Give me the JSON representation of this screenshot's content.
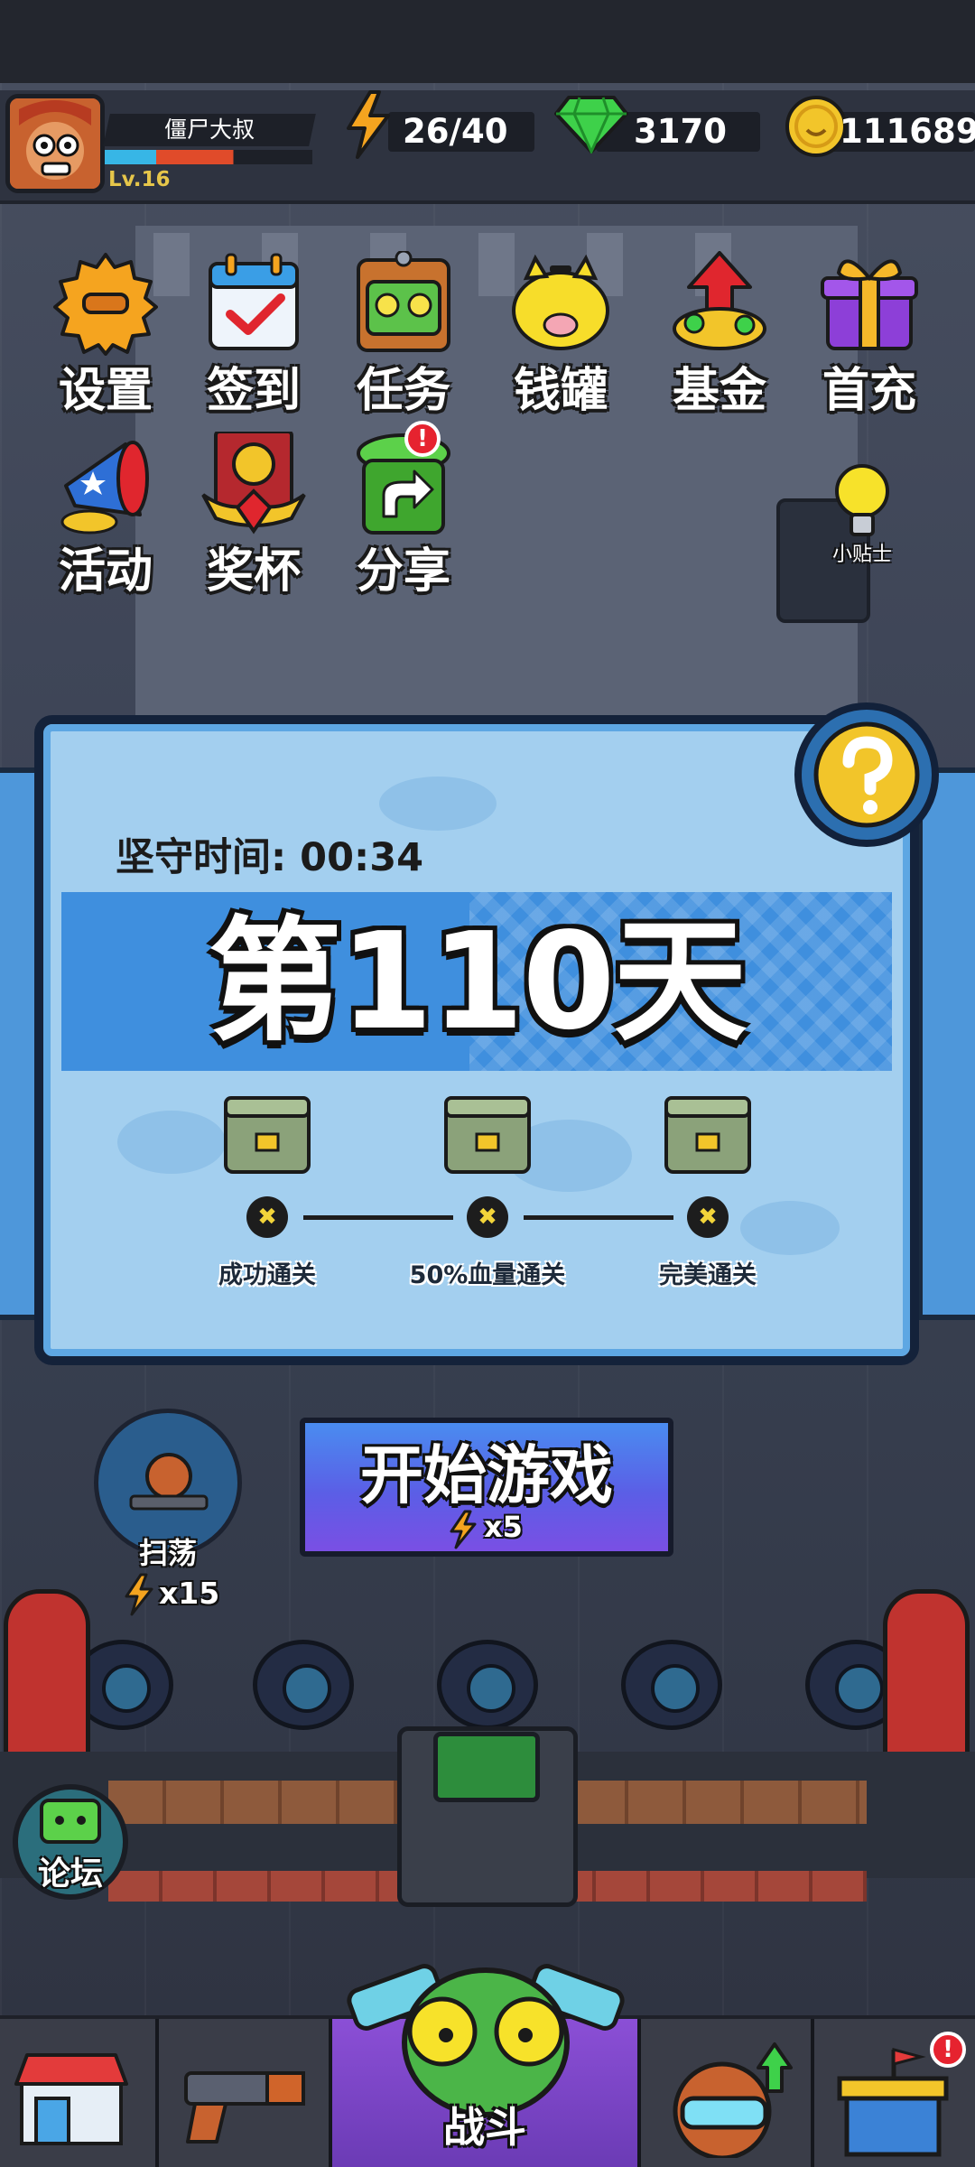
{
  "player": {
    "name": "僵尸大叔",
    "level": "Lv.16",
    "xp_fraction": 0.62
  },
  "resources": {
    "energy": "26/40",
    "gems": "3170",
    "coins": "111689"
  },
  "menu": {
    "settings": "设置",
    "checkin": "签到",
    "tasks": "任务",
    "piggybank": "钱罐",
    "fund": "基金",
    "first_recharge": "首充",
    "events": "活动",
    "trophy": "奖杯",
    "share": "分享"
  },
  "tips": {
    "label": "小贴士"
  },
  "level_panel": {
    "hold_time": "坚守时间: 00:34",
    "day_title": "第110天",
    "goals": [
      "成功通关",
      "50%血量通关",
      "完美通关"
    ]
  },
  "start": {
    "label": "开始游戏",
    "cost": "x5"
  },
  "sweep": {
    "label": "扫荡",
    "cost": "x15"
  },
  "forum": {
    "label": "论坛"
  },
  "nav": {
    "battle": "战斗"
  },
  "icons": {
    "energy": "lightning-icon",
    "gems": "gem-icon",
    "coins": "coin-icon",
    "help": "question-icon"
  },
  "colors": {
    "energy": "#f5a41f",
    "gem": "#3ed14a",
    "coin": "#f2c52a",
    "accent_blue": "#3f8fde",
    "badge": "#e6232f"
  }
}
